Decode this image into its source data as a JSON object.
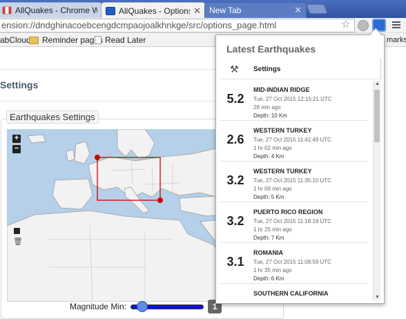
{
  "tabs": [
    {
      "title": "AllQuakes - Chrome Web",
      "icon": "gmail-like-favicon"
    },
    {
      "title": "AllQuakes - Options",
      "icon": "quake-favicon"
    },
    {
      "title": "New Tab",
      "icon": "none"
    }
  ],
  "toolbar": {
    "url": "ension://dndghinacoebcengdcmpaojoalkhnkge/src/options_page.html"
  },
  "bookmarks": [
    {
      "label": "abCloud",
      "icon": "folder-icon"
    },
    {
      "label": "Reminder pages",
      "icon": "folder-icon"
    },
    {
      "label": "Read Later",
      "icon": "page-icon"
    }
  ],
  "bookmarks_overflow": "marks",
  "page": {
    "settings_title": "Settings",
    "fieldset_legend": "Earthquakes Settings",
    "zoom_in": "+",
    "zoom_out": "−",
    "magnitude_label": "Magnitude Min:",
    "magnitude_value": "1",
    "magnitude_slider_fraction": 0.05
  },
  "popup": {
    "title": "Latest Earthquakes",
    "settings_label": "Settings",
    "quakes": [
      {
        "mag": "5.2",
        "region": "MID-INDIAN RIDGE",
        "time": "Tue, 27 Oct 2015 12:15:21 UTC",
        "ago": "28 min ago",
        "depth": "Depth: 10 Km"
      },
      {
        "mag": "2.6",
        "region": "WESTERN TURKEY",
        "time": "Tue, 27 Oct 2015 11:41:49 UTC",
        "ago": "1 hr 02 min ago",
        "depth": "Depth: 4 Km"
      },
      {
        "mag": "3.2",
        "region": "WESTERN TURKEY",
        "time": "Tue, 27 Oct 2015 11:35:10 UTC",
        "ago": "1 hr 09 min ago",
        "depth": "Depth: 5 Km"
      },
      {
        "mag": "3.2",
        "region": "PUERTO RICO REGION",
        "time": "Tue, 27 Oct 2015 11:18:19 UTC",
        "ago": "1 hr 25 min ago",
        "depth": "Depth: 7 Km"
      },
      {
        "mag": "3.1",
        "region": "ROMANIA",
        "time": "Tue, 27 Oct 2015 11:08:59 UTC",
        "ago": "1 hr 35 min ago",
        "depth": "Depth: 6 Km"
      },
      {
        "mag": "",
        "region": "SOUTHERN CALIFORNIA",
        "time": "",
        "ago": "",
        "depth": ""
      }
    ]
  },
  "colors": {
    "tabstrip": "#3f64b2",
    "water": "#b5d0e8",
    "land": "#f2f2f2",
    "selection": "#cc0000",
    "slider_track": "#1010e0"
  }
}
